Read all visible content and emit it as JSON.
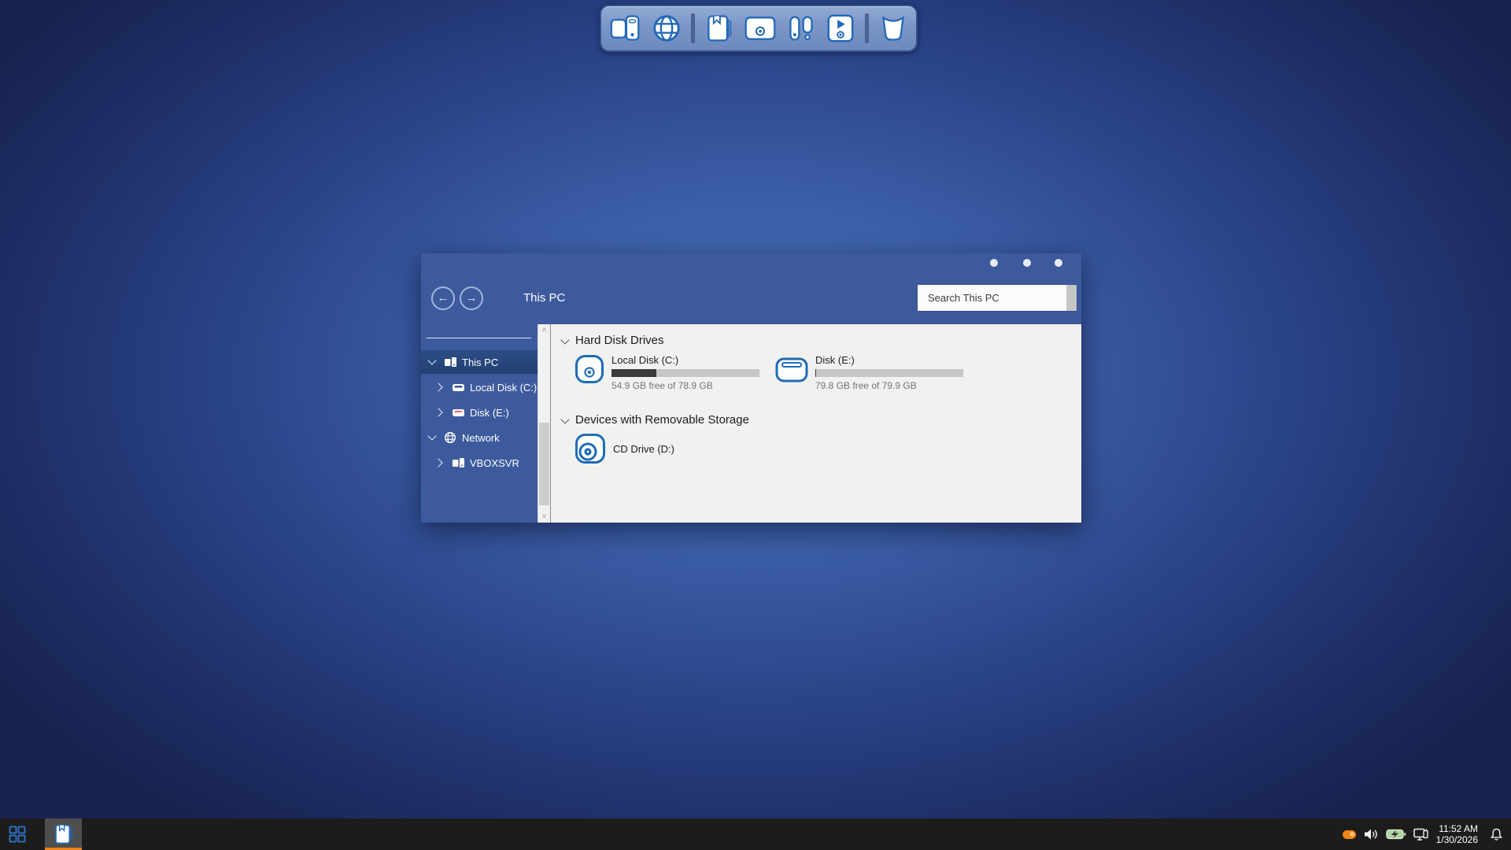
{
  "dock": {
    "icons": [
      "computer",
      "globe-browser",
      "book-library",
      "media-drive",
      "alerts",
      "media-player",
      "trash"
    ]
  },
  "window": {
    "location": "This PC",
    "search_placeholder": "Search This PC",
    "sidebar": {
      "items": [
        {
          "label": "This PC",
          "selected": true,
          "expanded": true
        },
        {
          "label": "Local Disk (C:)"
        },
        {
          "label": "Disk (E:)"
        },
        {
          "label": "Network",
          "expanded": true
        },
        {
          "label": "VBOXSVR"
        }
      ]
    },
    "content": {
      "sections": [
        {
          "title": "Hard Disk Drives",
          "drives": [
            {
              "label": "Local Disk (C:)",
              "free": "54.9 GB free of 78.9 GB",
              "usage_pct": 30.4
            },
            {
              "label": "Disk (E:)",
              "free": "79.8 GB free of 79.9 GB",
              "usage_pct": 0.5
            }
          ]
        },
        {
          "title": "Devices with Removable Storage",
          "drives": [
            {
              "label": "CD Drive (D:)"
            }
          ]
        }
      ]
    }
  },
  "taskbar": {
    "clock": {
      "time": "11:52 AM",
      "date": "1/30/2026"
    }
  },
  "colors": {
    "window_blue": "#3d5a9d",
    "selected_row": "#223f72",
    "content_bg": "#f1f1ef",
    "accent_orange": "#f08414",
    "taskbar_bg": "#1c1c1c",
    "icon_blue": "#2268b8",
    "bar_fill": "#3b3b3b",
    "bar_track": "#c6c6c6"
  }
}
